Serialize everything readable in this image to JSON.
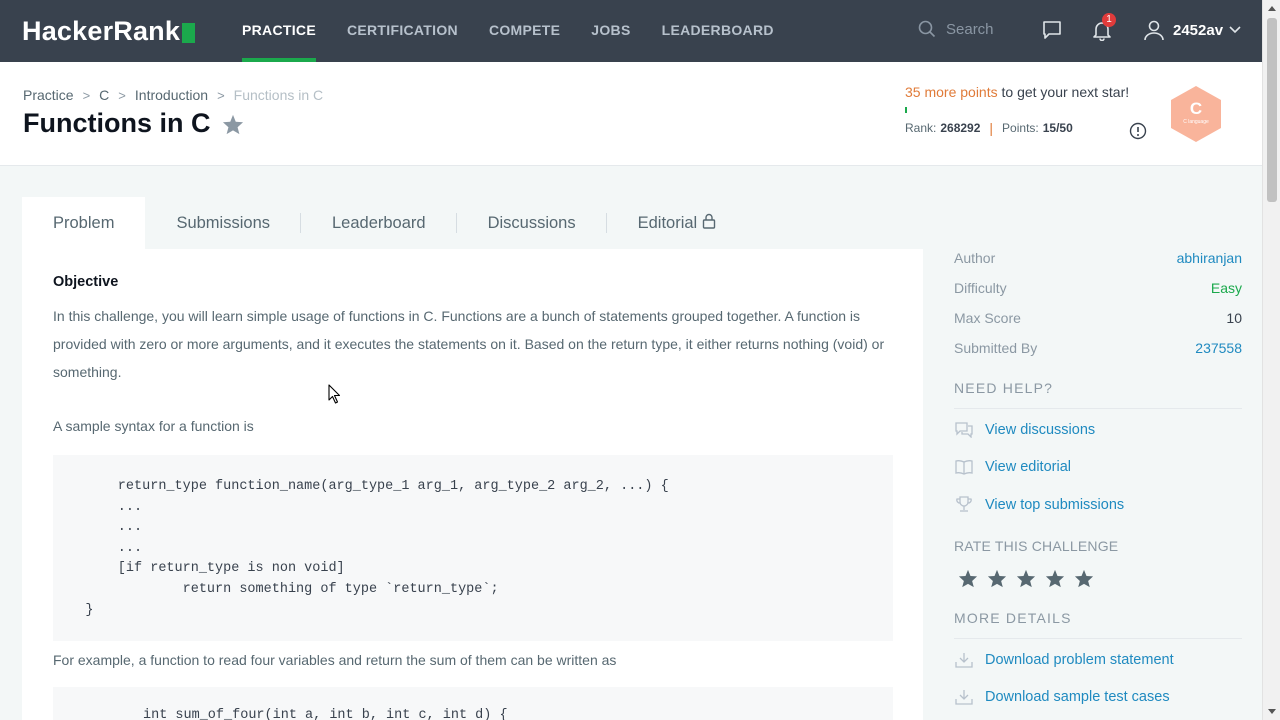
{
  "navbar": {
    "logo_text": "HackerRank",
    "links": [
      "PRACTICE",
      "CERTIFICATION",
      "COMPETE",
      "JOBS",
      "LEADERBOARD"
    ],
    "active_link": "PRACTICE",
    "search_placeholder": "Search",
    "notification_count": "1",
    "username": "2452av"
  },
  "header": {
    "breadcrumb": [
      "Practice",
      "C",
      "Introduction",
      "Functions in C"
    ],
    "title": "Functions in C",
    "points_needed": "35 more points",
    "points_suffix": " to get your next star!",
    "rank_label": "Rank:",
    "rank_value": "268292",
    "points_label": "Points:",
    "points_value": "15/50",
    "progress_fraction": 0.01,
    "badge_letter": "C",
    "badge_caption": "C language",
    "badge_color": "#f9b49b"
  },
  "tabs": [
    {
      "label": "Problem",
      "active": true
    },
    {
      "label": "Submissions",
      "active": false
    },
    {
      "label": "Leaderboard",
      "active": false
    },
    {
      "label": "Discussions",
      "active": false
    },
    {
      "label": "Editorial",
      "active": false,
      "locked": true
    }
  ],
  "problem": {
    "heading": "Objective",
    "intro": "In this challenge, you will learn simple usage of functions in C. Functions are a bunch of statements grouped together. A function is provided with zero or more arguments, and it executes the statements on it. Based on the return type, it either returns nothing (void) or something.",
    "syntax_intro": "A sample syntax for a function is",
    "code_lines": [
      "        return_type function_name(arg_type_1 arg_1, arg_type_2 arg_2, ...) {",
      "        ...",
      "        ...",
      "        ...",
      "        [if return_type is non void]",
      "                return something of type `return_type`;",
      "    }"
    ],
    "example_intro": "For example, a function to read four variables and return the sum of them can be written as",
    "code2_line": "int sum_of_four(int a, int b, int c, int d) {"
  },
  "sidebar": {
    "meta": [
      {
        "key": "Author",
        "value": "abhiranjan"
      },
      {
        "key": "Difficulty",
        "value": "Easy"
      },
      {
        "key": "Max Score",
        "value": "10"
      },
      {
        "key": "Submitted By",
        "value": "237558"
      }
    ],
    "need_help": "NEED HELP?",
    "help_links": [
      "View discussions",
      "View editorial",
      "View top submissions"
    ],
    "rate_title": "RATE THIS CHALLENGE",
    "rating_stars": 5,
    "more_details": "MORE DETAILS",
    "download_links": [
      "Download problem statement",
      "Download sample test cases"
    ]
  },
  "colors": {
    "nav_bg": "#39424e",
    "brand_green": "#1ba94c",
    "link_blue": "#1f8ac0",
    "accent_orange": "#e07b39"
  }
}
